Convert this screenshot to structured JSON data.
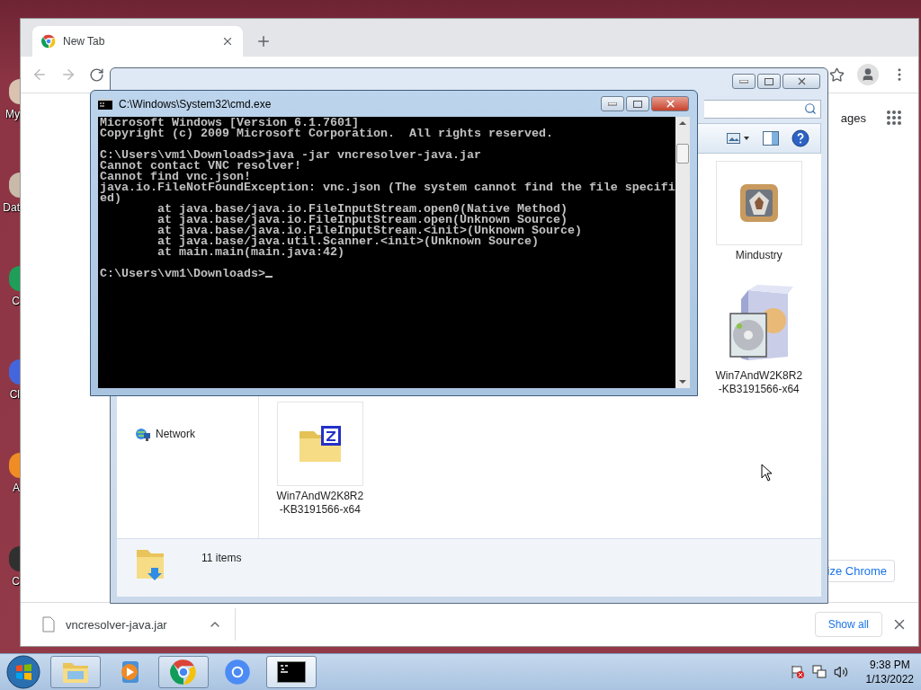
{
  "desktop": {
    "icons": [
      {
        "label": "My"
      },
      {
        "label": "Dat"
      },
      {
        "label": "C"
      },
      {
        "label": "Cl"
      },
      {
        "label": "A"
      },
      {
        "label": "C"
      }
    ]
  },
  "chrome": {
    "tabs": [
      {
        "title": "New Tab",
        "selected": true
      }
    ],
    "page": {
      "top_link": "ages",
      "customize_button": "ize Chrome"
    },
    "download_bar": {
      "items": [
        {
          "filename": "vncresolver-java.jar"
        }
      ],
      "show_all": "Show all"
    }
  },
  "explorer": {
    "nav": [
      {
        "kind": "network",
        "label": "Network"
      }
    ],
    "files": [
      {
        "kind": "game",
        "name": [
          "Mindustry"
        ]
      },
      {
        "kind": "installer",
        "name": [
          "Win7AndW2K8R2",
          "-KB3191566-x64"
        ]
      },
      {
        "kind": "zip",
        "name": [
          "Win7AndW2K8R2",
          "-KB3191566-x64"
        ]
      }
    ],
    "status": "11 items"
  },
  "cmd": {
    "title": "C:\\Windows\\System32\\cmd.exe",
    "prompt_cursor": true,
    "blocks": [
      [
        {
          "kind": "output",
          "text": "Microsoft Windows [Version 6.1.7601]"
        },
        {
          "kind": "output",
          "text": "Copyright (c) 2009 Microsoft Corporation.  All rights reserved."
        }
      ],
      [
        {
          "kind": "output",
          "text": "C:\\Users\\vm1\\Downloads>java -jar vncresolver-java.jar"
        },
        {
          "kind": "output",
          "text": "Cannot contact VNC resolver!"
        },
        {
          "kind": "output",
          "text": "Cannot find vnc.json!"
        },
        {
          "kind": "output",
          "text": "java.io.FileNotFoundException: vnc.json (The system cannot find the file specifi"
        },
        {
          "kind": "output",
          "text": "ed)"
        },
        {
          "kind": "trace",
          "text": "at java.base/java.io.FileInputStream.open0(Native Method)"
        },
        {
          "kind": "trace",
          "text": "at java.base/java.io.FileInputStream.open(Unknown Source)"
        },
        {
          "kind": "trace",
          "text": "at java.base/java.io.FileInputStream.<init>(Unknown Source)"
        },
        {
          "kind": "trace",
          "text": "at java.base/java.util.Scanner.<init>(Unknown Source)"
        },
        {
          "kind": "trace",
          "text": "at main.main(main.java:42)"
        }
      ],
      [
        {
          "kind": "output",
          "text": "C:\\Users\\vm1\\Downloads>"
        }
      ]
    ]
  },
  "taskbar": {
    "buttons": [
      {
        "kind": "explorer",
        "running": true,
        "selected": false
      },
      {
        "kind": "media",
        "running": false,
        "selected": false
      },
      {
        "kind": "chrome",
        "running": true,
        "selected": false
      },
      {
        "kind": "chromium",
        "running": false,
        "selected": false
      },
      {
        "kind": "cmd",
        "running": true,
        "selected": true
      }
    ],
    "clock": {
      "time": "9:38 PM",
      "date": "1/13/2022"
    }
  }
}
